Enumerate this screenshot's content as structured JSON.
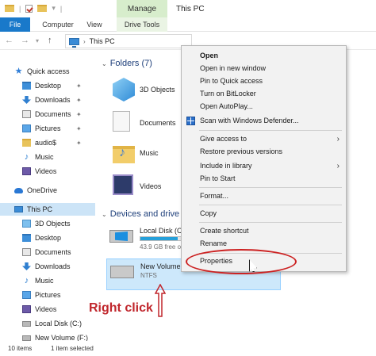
{
  "titlebar": {
    "manage_tab": "Manage",
    "window_title": "This PC",
    "qat_separator": "|",
    "qat_dropdown": "▾"
  },
  "ribbon": {
    "tabs": [
      {
        "label": "File"
      },
      {
        "label": "Computer"
      },
      {
        "label": "View"
      },
      {
        "label": "Drive Tools"
      }
    ]
  },
  "navbar": {
    "back": "←",
    "forward": "→",
    "recent": "▾",
    "up": "↑",
    "address": "This PC",
    "address_chevron": "›"
  },
  "sidebar": {
    "items": [
      {
        "label": "Quick access",
        "icon": "star-icon"
      },
      {
        "label": "Desktop",
        "icon": "desktop-folder-icon",
        "pinned": true
      },
      {
        "label": "Downloads",
        "icon": "download-icon",
        "pinned": true
      },
      {
        "label": "Documents",
        "icon": "documents-icon",
        "pinned": true
      },
      {
        "label": "Pictures",
        "icon": "pictures-icon",
        "pinned": true
      },
      {
        "label": "audio$",
        "icon": "folder-icon",
        "pinned": true
      },
      {
        "label": "Music",
        "icon": "music-icon"
      },
      {
        "label": "Videos",
        "icon": "videos-icon"
      },
      {
        "label": "OneDrive",
        "icon": "onedrive-icon"
      },
      {
        "label": "This PC",
        "icon": "this-pc-icon",
        "selected": true
      },
      {
        "label": "3D Objects",
        "icon": "3d-objects-icon"
      },
      {
        "label": "Desktop",
        "icon": "desktop-folder-icon"
      },
      {
        "label": "Documents",
        "icon": "documents-icon"
      },
      {
        "label": "Downloads",
        "icon": "download-icon"
      },
      {
        "label": "Music",
        "icon": "music-icon"
      },
      {
        "label": "Pictures",
        "icon": "pictures-icon"
      },
      {
        "label": "Videos",
        "icon": "videos-icon"
      },
      {
        "label": "Local Disk (C:)",
        "icon": "drive-icon"
      },
      {
        "label": "New Volume (F:)",
        "icon": "drive-icon"
      }
    ],
    "pin_glyph": "📌",
    "chevron": "›"
  },
  "content": {
    "folders_header": "Folders (7)",
    "folders": [
      {
        "label": "3D Objects"
      },
      {
        "label": "Documents"
      },
      {
        "label": "Music"
      },
      {
        "label": "Videos"
      }
    ],
    "devices_header": "Devices and drive",
    "drives": [
      {
        "name": "Local Disk (C:)",
        "sub": "43.9 GB free of 88",
        "used_fraction": 0.5
      },
      {
        "name": "New Volume (F:)",
        "sub": "NTFS",
        "selected": true
      }
    ]
  },
  "context_menu": {
    "items": [
      {
        "label": "Open",
        "bold": true
      },
      {
        "label": "Open in new window"
      },
      {
        "label": "Pin to Quick access"
      },
      {
        "label": "Turn on BitLocker"
      },
      {
        "label": "Open AutoPlay..."
      },
      {
        "label": "Scan with Windows Defender...",
        "icon": "defender-icon"
      },
      {
        "label": "Give access to",
        "submenu": true
      },
      {
        "label": "Restore previous versions"
      },
      {
        "label": "Include in library",
        "submenu": true
      },
      {
        "label": "Pin to Start"
      },
      {
        "label": "Format..."
      },
      {
        "label": "Copy"
      },
      {
        "label": "Create shortcut"
      },
      {
        "label": "Rename"
      },
      {
        "label": "Properties"
      }
    ],
    "submenu_arrow": "›"
  },
  "annotation": {
    "right_click": "Right click",
    "highlight_color": "#cc2222"
  },
  "status": {
    "items_count": "10 items",
    "selected_count": "1 item selected"
  },
  "colors": {
    "file_tab": "#1979ca",
    "manage_tab": "#d7edcc",
    "selection": "#cce4f7"
  }
}
